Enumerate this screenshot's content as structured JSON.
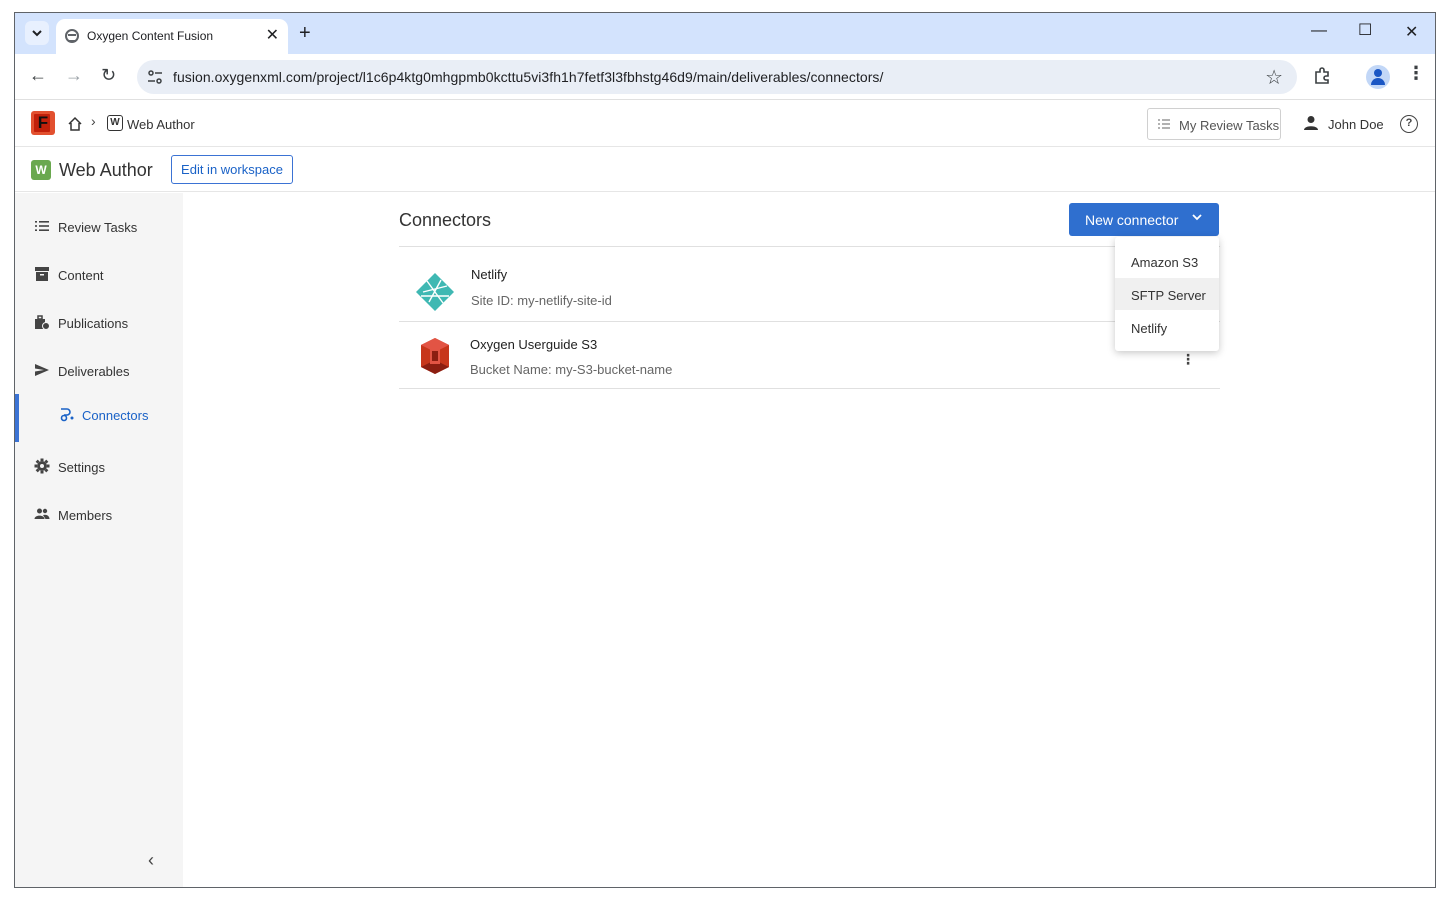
{
  "browser": {
    "tab_title": "Oxygen Content Fusion",
    "url": "fusion.oxygenxml.com/project/l1c6p4ktg0mhgpmb0kcttu5vi3fh1h7fetf3l3fbhstg46d9/main/deliverables/connectors/"
  },
  "header": {
    "logo_letter": "F",
    "breadcrumb_badge": "W",
    "breadcrumb_label": "Web Author",
    "review_tasks_button": "My Review Tasks",
    "user_name": "John Doe",
    "help_symbol": "?"
  },
  "project": {
    "badge": "W",
    "title": "Web Author",
    "edit_button": "Edit in workspace"
  },
  "sidebar": {
    "items": [
      {
        "label": "Review Tasks",
        "icon": "list-icon"
      },
      {
        "label": "Content",
        "icon": "archive-icon"
      },
      {
        "label": "Publications",
        "icon": "publications-icon"
      },
      {
        "label": "Deliverables",
        "icon": "send-icon"
      },
      {
        "label": "Connectors",
        "icon": "connectors-icon"
      },
      {
        "label": "Settings",
        "icon": "gear-icon"
      },
      {
        "label": "Members",
        "icon": "people-icon"
      }
    ]
  },
  "main": {
    "title": "Connectors",
    "new_button": "New connector",
    "connectors": [
      {
        "name": "Netlify",
        "detail": "Site ID: my-netlify-site-id",
        "icon": "netlify-logo-icon"
      },
      {
        "name": "Oxygen Userguide S3",
        "detail": "Bucket Name: my-S3-bucket-name",
        "icon": "amazon-s3-logo-icon"
      }
    ],
    "dropdown": {
      "items": [
        "Amazon S3",
        "SFTP Server",
        "Netlify"
      ],
      "hovered": "SFTP Server"
    }
  },
  "colors": {
    "accent": "#2f6fcf",
    "tabstrip": "#d3e3fd",
    "project_badge": "#6aa84f",
    "logo": "#e2502f"
  }
}
